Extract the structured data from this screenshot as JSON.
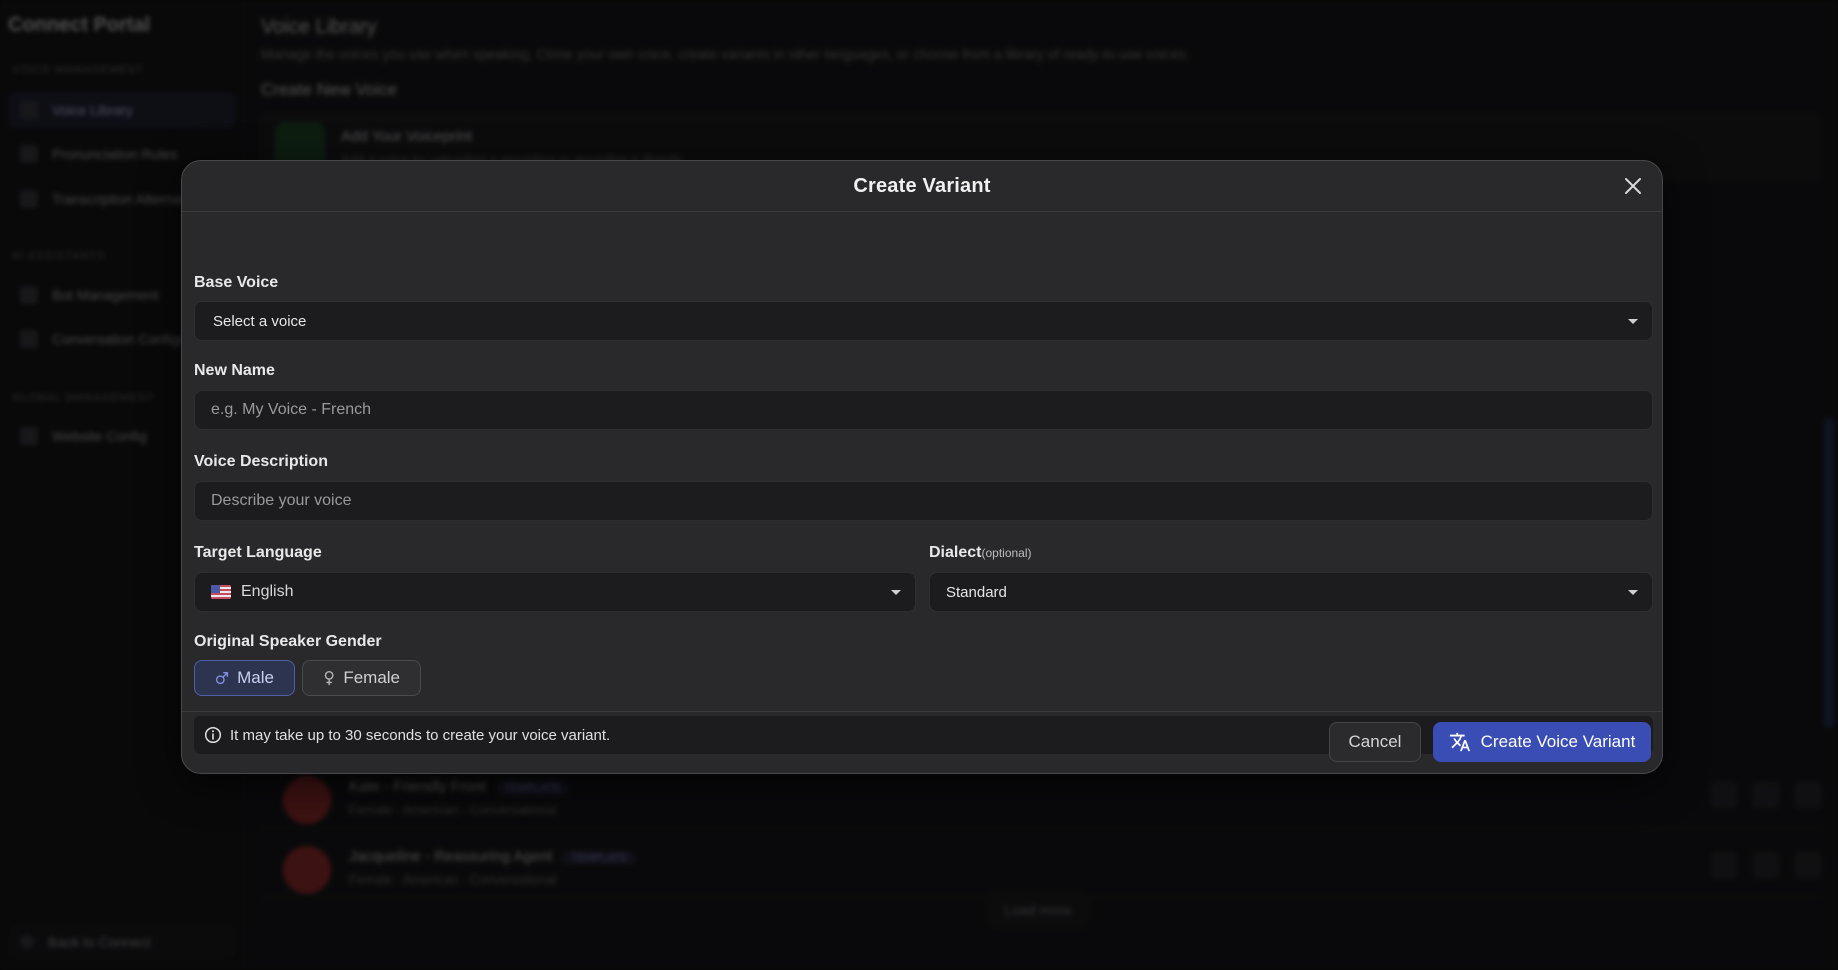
{
  "background": {
    "brand": "Connect Portal",
    "sections": [
      "Voice Management",
      "AI Assistants",
      "Global Management"
    ],
    "sidebar_items": [
      "Voice Library",
      "Pronunciation Rules",
      "Transcription Alternatives",
      "Bot Management",
      "Conversation Configs",
      "Website Config"
    ],
    "back_label": "Back to Connect",
    "page_title": "Voice Library",
    "page_subtitle": "Manage the voices you use when speaking. Clone your own voice, create variants in other languages, or choose from a library of ready-to-use voices.",
    "section_title": "Create New Voice",
    "add_card_title": "Add Your Voiceprint",
    "add_card_subtitle": "Add a voice by uploading a recording or recording it directly",
    "rows": [
      {
        "name": "Kate - Friendly Front",
        "tag": "TEMPLATE",
        "meta": "Female · American · Conversational"
      },
      {
        "name": "Jacqueline - Reassuring Agent",
        "tag": "TEMPLATE",
        "meta": "Female · American · Conversational"
      }
    ],
    "load_more": "Load more"
  },
  "modal": {
    "title": "Create Variant",
    "base_voice": {
      "label": "Base Voice",
      "value": "Select a voice"
    },
    "new_name": {
      "label": "New Name",
      "placeholder": "e.g. My Voice - French"
    },
    "description": {
      "label": "Voice Description",
      "placeholder": "Describe your voice"
    },
    "target_language": {
      "label": "Target Language",
      "value": "English"
    },
    "dialect": {
      "label": "Dialect",
      "optional": "(optional)",
      "value": "Standard"
    },
    "gender": {
      "label": "Original Speaker Gender",
      "male": "Male",
      "female": "Female",
      "selected": "Male"
    },
    "info": "It may take up to 30 seconds to create your voice variant.",
    "cancel": "Cancel",
    "create": "Create Voice Variant"
  },
  "colors": {
    "accent": "#3a4db5",
    "modal_bg": "#29292b",
    "input_bg": "#1c1c1e"
  }
}
